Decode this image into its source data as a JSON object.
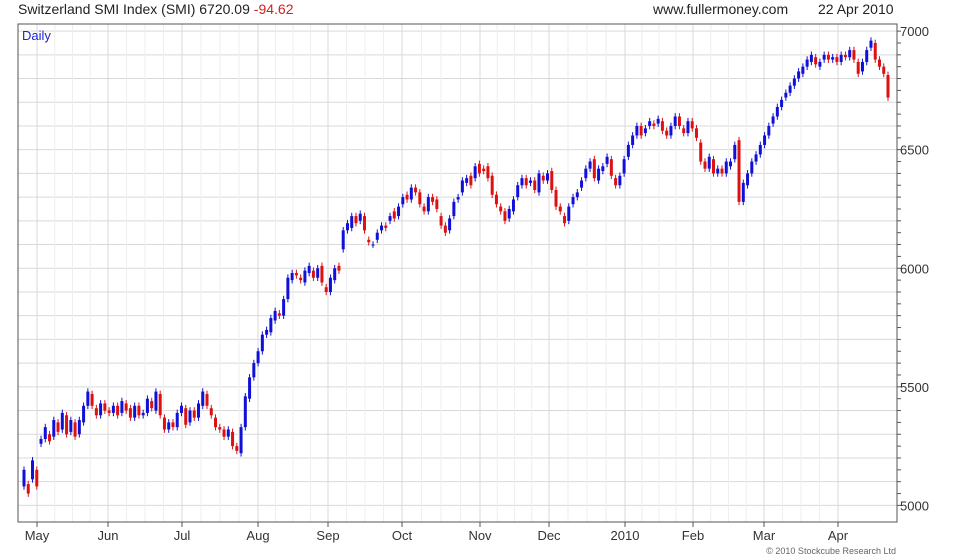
{
  "header": {
    "title": "Switzerland SMI Index (SMI) 6720.09",
    "change": "-94.62",
    "site": "www.fullermoney.com",
    "date": "22 Apr 2010"
  },
  "period_label": "Daily",
  "copyright": "© 2010 Stockcube Research Ltd",
  "colors": {
    "up": "#1010d8",
    "down": "#dd1111",
    "grid": "#d9d9d9",
    "frame": "#555555"
  },
  "chart_data": {
    "type": "candlestick",
    "title": "Switzerland SMI Index (SMI) 6720.09 -94.62",
    "x_ticks": [
      "May",
      "Jun",
      "Jul",
      "Aug",
      "Sep",
      "Oct",
      "Nov",
      "Dec",
      "2010",
      "Feb",
      "Mar",
      "Apr"
    ],
    "y_ticks": [
      5000,
      5500,
      6000,
      6500,
      7000
    ],
    "ylim": [
      4930,
      7030
    ],
    "grid": true,
    "series": [
      {
        "values": [
          [
            5080,
            5150
          ],
          [
            5090,
            5050
          ],
          [
            5110,
            5190
          ],
          [
            5150,
            5080
          ],
          [
            5260,
            5280
          ],
          [
            5280,
            5330
          ],
          [
            5300,
            5270
          ],
          [
            5290,
            5360
          ],
          [
            5350,
            5310
          ],
          [
            5320,
            5390
          ],
          [
            5380,
            5300
          ],
          [
            5310,
            5360
          ],
          [
            5350,
            5290
          ],
          [
            5300,
            5360
          ],
          [
            5350,
            5420
          ],
          [
            5420,
            5480
          ],
          [
            5470,
            5420
          ],
          [
            5410,
            5380
          ],
          [
            5380,
            5430
          ],
          [
            5430,
            5400
          ],
          [
            5400,
            5390
          ],
          [
            5390,
            5420
          ],
          [
            5420,
            5380
          ],
          [
            5390,
            5440
          ],
          [
            5430,
            5400
          ],
          [
            5410,
            5370
          ],
          [
            5370,
            5420
          ],
          [
            5420,
            5380
          ],
          [
            5380,
            5390
          ],
          [
            5390,
            5450
          ],
          [
            5440,
            5410
          ],
          [
            5400,
            5480
          ],
          [
            5470,
            5380
          ],
          [
            5370,
            5320
          ],
          [
            5320,
            5350
          ],
          [
            5350,
            5330
          ],
          [
            5330,
            5390
          ],
          [
            5390,
            5420
          ],
          [
            5410,
            5340
          ],
          [
            5350,
            5400
          ],
          [
            5400,
            5370
          ],
          [
            5370,
            5430
          ],
          [
            5420,
            5480
          ],
          [
            5470,
            5420
          ],
          [
            5410,
            5380
          ],
          [
            5370,
            5330
          ],
          [
            5330,
            5320
          ],
          [
            5320,
            5290
          ],
          [
            5290,
            5320
          ],
          [
            5310,
            5250
          ],
          [
            5250,
            5230
          ],
          [
            5220,
            5330
          ],
          [
            5330,
            5460
          ],
          [
            5450,
            5540
          ],
          [
            5540,
            5600
          ],
          [
            5600,
            5650
          ],
          [
            5650,
            5720
          ],
          [
            5720,
            5740
          ],
          [
            5730,
            5790
          ],
          [
            5780,
            5820
          ],
          [
            5810,
            5800
          ],
          [
            5800,
            5870
          ],
          [
            5870,
            5960
          ],
          [
            5950,
            5980
          ],
          [
            5980,
            5970
          ],
          [
            5960,
            5950
          ],
          [
            5940,
            5990
          ],
          [
            5980,
            6010
          ],
          [
            5990,
            5960
          ],
          [
            5960,
            6000
          ],
          [
            6010,
            5940
          ],
          [
            5920,
            5900
          ],
          [
            5900,
            5960
          ],
          [
            5950,
            6000
          ],
          [
            6010,
            5990
          ],
          [
            6080,
            6160
          ],
          [
            6160,
            6190
          ],
          [
            6170,
            6220
          ],
          [
            6220,
            6190
          ],
          [
            6200,
            6230
          ],
          [
            6220,
            6160
          ],
          [
            6120,
            6110
          ],
          [
            6100,
            6100
          ],
          [
            6120,
            6150
          ],
          [
            6160,
            6180
          ],
          [
            6180,
            6170
          ],
          [
            6200,
            6220
          ],
          [
            6240,
            6210
          ],
          [
            6220,
            6260
          ],
          [
            6270,
            6300
          ],
          [
            6310,
            6290
          ],
          [
            6290,
            6340
          ],
          [
            6340,
            6320
          ],
          [
            6320,
            6270
          ],
          [
            6260,
            6240
          ],
          [
            6240,
            6300
          ],
          [
            6300,
            6280
          ],
          [
            6290,
            6250
          ],
          [
            6220,
            6180
          ],
          [
            6180,
            6150
          ],
          [
            6160,
            6210
          ],
          [
            6220,
            6280
          ],
          [
            6290,
            6300
          ],
          [
            6320,
            6370
          ],
          [
            6360,
            6380
          ],
          [
            6390,
            6350
          ],
          [
            6380,
            6430
          ],
          [
            6440,
            6400
          ],
          [
            6420,
            6410
          ],
          [
            6430,
            6380
          ],
          [
            6390,
            6310
          ],
          [
            6310,
            6270
          ],
          [
            6260,
            6240
          ],
          [
            6240,
            6200
          ],
          [
            6210,
            6250
          ],
          [
            6240,
            6290
          ],
          [
            6300,
            6350
          ],
          [
            6350,
            6380
          ],
          [
            6380,
            6350
          ],
          [
            6360,
            6370
          ],
          [
            6370,
            6330
          ],
          [
            6320,
            6400
          ],
          [
            6390,
            6370
          ],
          [
            6370,
            6400
          ],
          [
            6410,
            6330
          ],
          [
            6330,
            6260
          ],
          [
            6260,
            6240
          ],
          [
            6220,
            6190
          ],
          [
            6200,
            6260
          ],
          [
            6270,
            6300
          ],
          [
            6300,
            6320
          ],
          [
            6340,
            6370
          ],
          [
            6380,
            6420
          ],
          [
            6420,
            6450
          ],
          [
            6460,
            6380
          ],
          [
            6370,
            6420
          ],
          [
            6410,
            6430
          ],
          [
            6440,
            6470
          ],
          [
            6460,
            6390
          ],
          [
            6380,
            6350
          ],
          [
            6350,
            6390
          ],
          [
            6400,
            6460
          ],
          [
            6470,
            6520
          ],
          [
            6520,
            6560
          ],
          [
            6560,
            6600
          ],
          [
            6600,
            6560
          ],
          [
            6570,
            6590
          ],
          [
            6600,
            6620
          ],
          [
            6610,
            6600
          ],
          [
            6610,
            6630
          ],
          [
            6620,
            6580
          ],
          [
            6580,
            6560
          ],
          [
            6560,
            6600
          ],
          [
            6600,
            6640
          ],
          [
            6640,
            6600
          ],
          [
            6590,
            6570
          ],
          [
            6570,
            6620
          ],
          [
            6620,
            6590
          ],
          [
            6590,
            6550
          ],
          [
            6530,
            6450
          ],
          [
            6450,
            6420
          ],
          [
            6420,
            6470
          ],
          [
            6460,
            6400
          ],
          [
            6400,
            6420
          ],
          [
            6420,
            6400
          ],
          [
            6400,
            6450
          ],
          [
            6430,
            6450
          ],
          [
            6460,
            6520
          ],
          [
            6540,
            6280
          ],
          [
            6280,
            6360
          ],
          [
            6350,
            6400
          ],
          [
            6400,
            6450
          ],
          [
            6450,
            6480
          ],
          [
            6480,
            6520
          ],
          [
            6520,
            6560
          ],
          [
            6560,
            6600
          ],
          [
            6610,
            6640
          ],
          [
            6640,
            6680
          ],
          [
            6680,
            6710
          ],
          [
            6720,
            6740
          ],
          [
            6740,
            6770
          ],
          [
            6770,
            6800
          ],
          [
            6800,
            6830
          ],
          [
            6820,
            6850
          ],
          [
            6850,
            6880
          ],
          [
            6870,
            6900
          ],
          [
            6890,
            6860
          ],
          [
            6850,
            6870
          ],
          [
            6880,
            6900
          ],
          [
            6900,
            6880
          ],
          [
            6880,
            6890
          ],
          [
            6890,
            6870
          ],
          [
            6870,
            6900
          ],
          [
            6900,
            6890
          ],
          [
            6890,
            6920
          ],
          [
            6920,
            6880
          ],
          [
            6870,
            6820
          ],
          [
            6830,
            6870
          ],
          [
            6870,
            6920
          ],
          [
            6930,
            6960
          ],
          [
            6950,
            6880
          ],
          [
            6880,
            6850
          ],
          [
            6850,
            6820
          ],
          [
            6815,
            6720
          ]
        ]
      }
    ]
  }
}
